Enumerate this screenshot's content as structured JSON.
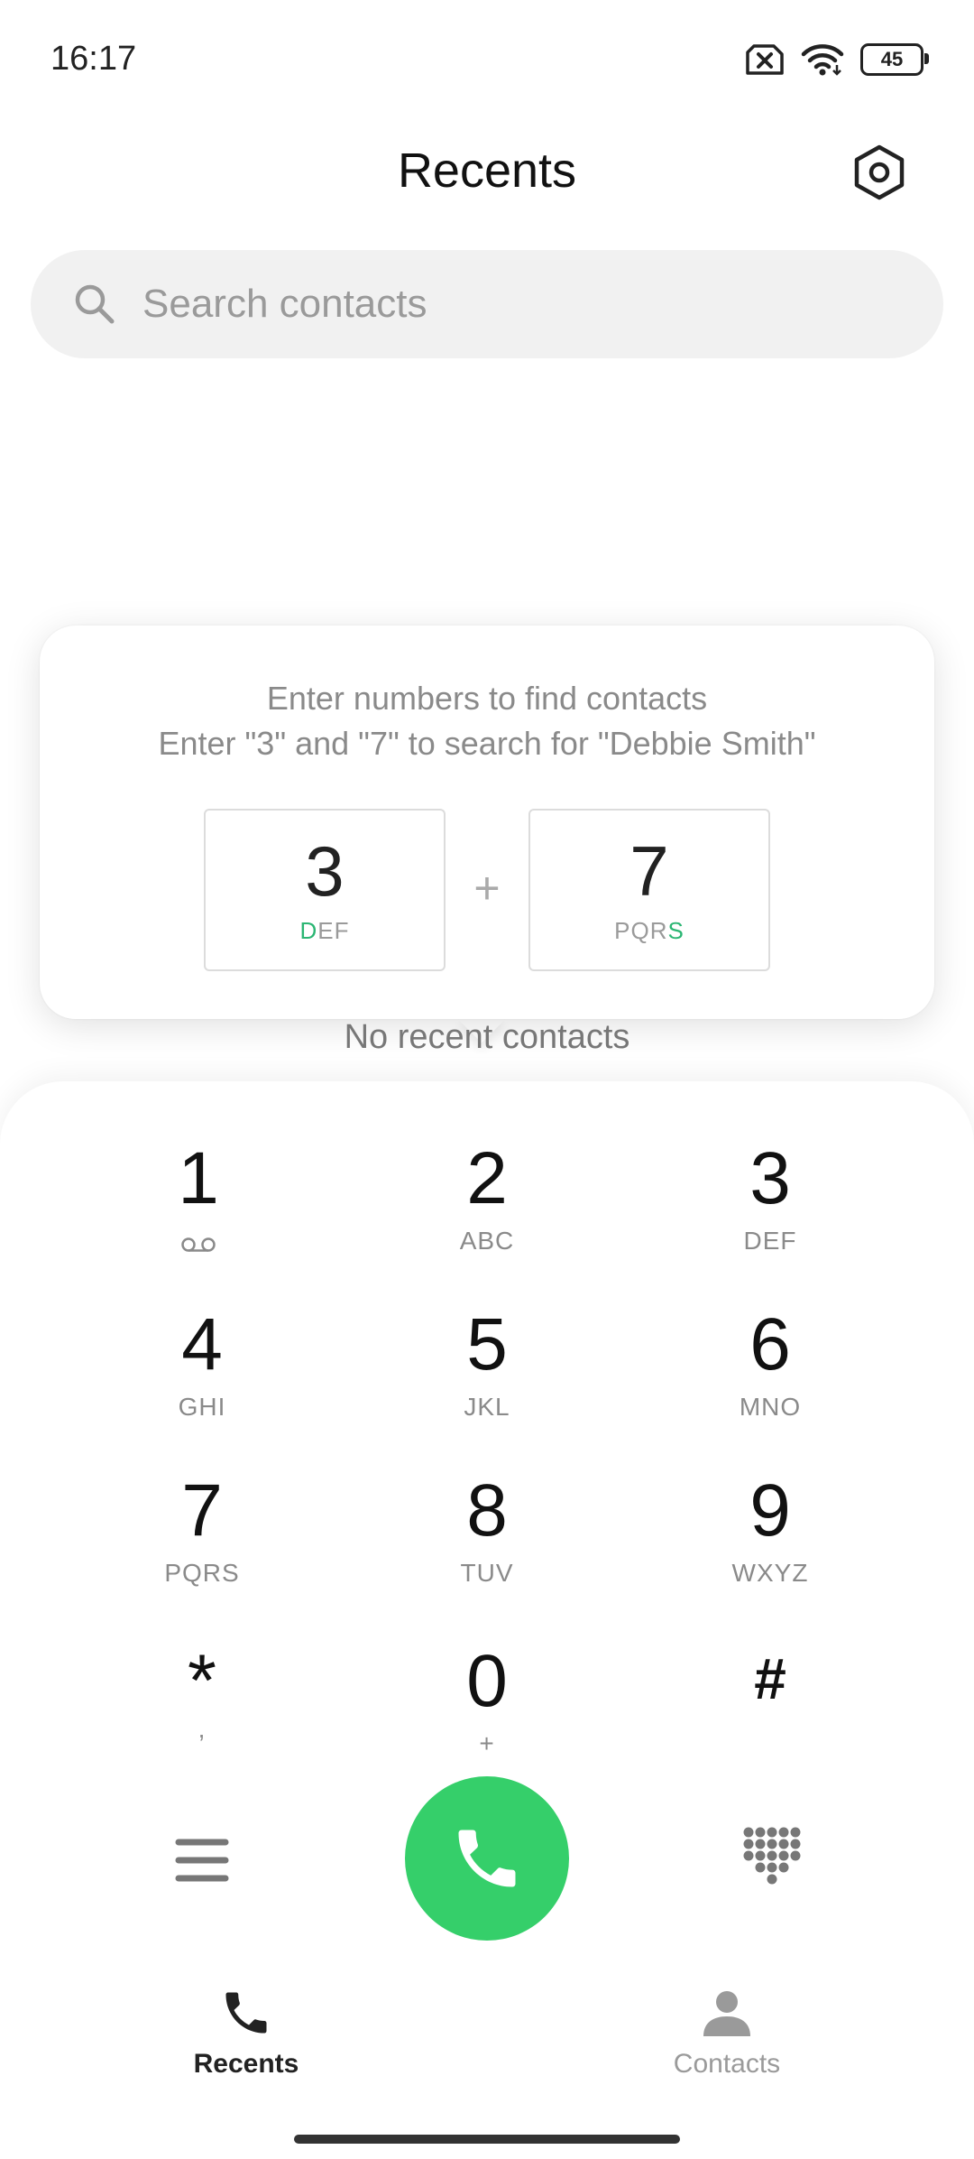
{
  "status_bar": {
    "time": "16:17",
    "battery": "45"
  },
  "header": {
    "title": "Recents"
  },
  "search": {
    "placeholder": "Search contacts"
  },
  "tip": {
    "line1": "Enter numbers to find contacts",
    "line2": "Enter \"3\" and \"7\" to search for \"Debbie Smith\"",
    "plus": "+",
    "key_a": {
      "digit": "3",
      "highlight": "D",
      "rest": "EF"
    },
    "key_b": {
      "digit": "7",
      "rest": "PQR",
      "highlight": "S"
    },
    "highlight_color": "#2bb673"
  },
  "empty_state": "No recent contacts",
  "dialpad": {
    "keys": [
      {
        "num": "1",
        "sub": ""
      },
      {
        "num": "2",
        "sub": "ABC"
      },
      {
        "num": "3",
        "sub": "DEF"
      },
      {
        "num": "4",
        "sub": "GHI"
      },
      {
        "num": "5",
        "sub": "JKL"
      },
      {
        "num": "6",
        "sub": "MNO"
      },
      {
        "num": "7",
        "sub": "PQRS"
      },
      {
        "num": "8",
        "sub": "TUV"
      },
      {
        "num": "9",
        "sub": "WXYZ"
      },
      {
        "num": "*",
        "sub": ","
      },
      {
        "num": "0",
        "sub": "+"
      },
      {
        "num": "#",
        "sub": ""
      }
    ],
    "voicemail_icon": "voicemail-icon",
    "call_color": "#35cf6a"
  },
  "bottom_nav": {
    "recents": "Recents",
    "contacts": "Contacts"
  }
}
